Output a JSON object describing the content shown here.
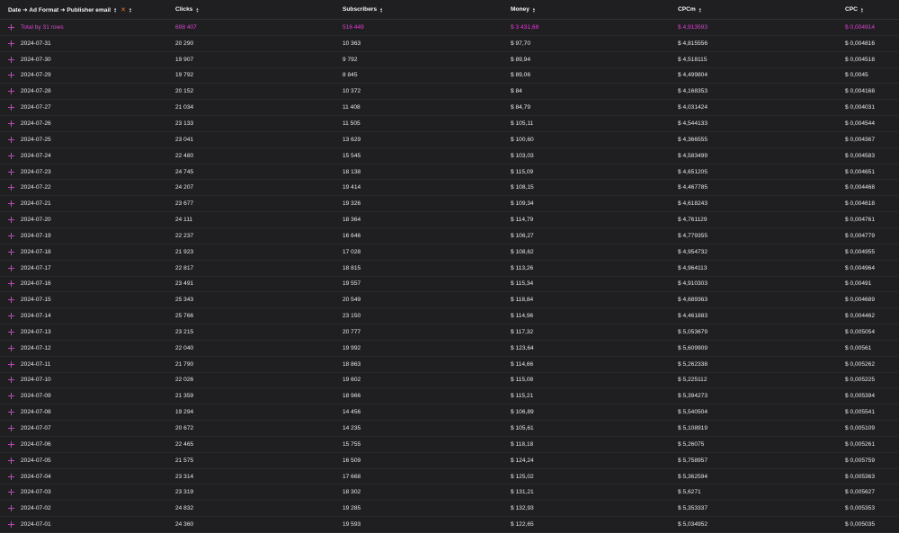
{
  "header": {
    "group_label": "Date ➜ Ad Format ➜ Publisher email",
    "close_glyph": "✕",
    "clicks": "Clicks",
    "subscribers": "Subscribers",
    "money": "Money",
    "cpcm": "CPCm",
    "cpc": "CPC"
  },
  "total": {
    "label": "Total by 31 rows",
    "clicks": "698 407",
    "subscribers": "516 449",
    "money": "$ 3 431,68",
    "cpcm": "$ 4,913593",
    "cpc": "$ 0,004914"
  },
  "rows": [
    {
      "date": "2024-07-31",
      "clicks": "20 290",
      "subscribers": "10 363",
      "money": "$ 97,70",
      "cpcm": "$ 4,815556",
      "cpc": "$ 0,004816"
    },
    {
      "date": "2024-07-30",
      "clicks": "19 907",
      "subscribers": "9 792",
      "money": "$ 89,94",
      "cpcm": "$ 4,518115",
      "cpc": "$ 0,004518"
    },
    {
      "date": "2024-07-29",
      "clicks": "19 792",
      "subscribers": "8 845",
      "money": "$ 89,06",
      "cpcm": "$ 4,499804",
      "cpc": "$ 0,0045"
    },
    {
      "date": "2024-07-28",
      "clicks": "20 152",
      "subscribers": "10 372",
      "money": "$ 84",
      "cpcm": "$ 4,168353",
      "cpc": "$ 0,004168"
    },
    {
      "date": "2024-07-27",
      "clicks": "21 034",
      "subscribers": "11 408",
      "money": "$ 84,79",
      "cpcm": "$ 4,031424",
      "cpc": "$ 0,004031"
    },
    {
      "date": "2024-07-26",
      "clicks": "23 133",
      "subscribers": "11 505",
      "money": "$ 105,11",
      "cpcm": "$ 4,544133",
      "cpc": "$ 0,004544"
    },
    {
      "date": "2024-07-25",
      "clicks": "23 041",
      "subscribers": "13 629",
      "money": "$ 100,60",
      "cpcm": "$ 4,366555",
      "cpc": "$ 0,004367"
    },
    {
      "date": "2024-07-24",
      "clicks": "22 480",
      "subscribers": "15 545",
      "money": "$ 103,03",
      "cpcm": "$ 4,583499",
      "cpc": "$ 0,004583"
    },
    {
      "date": "2024-07-23",
      "clicks": "24 745",
      "subscribers": "18 138",
      "money": "$ 115,09",
      "cpcm": "$ 4,651205",
      "cpc": "$ 0,004651"
    },
    {
      "date": "2024-07-22",
      "clicks": "24 207",
      "subscribers": "19 414",
      "money": "$ 108,15",
      "cpcm": "$ 4,467785",
      "cpc": "$ 0,004468"
    },
    {
      "date": "2024-07-21",
      "clicks": "23 677",
      "subscribers": "19 326",
      "money": "$ 109,34",
      "cpcm": "$ 4,618243",
      "cpc": "$ 0,004618"
    },
    {
      "date": "2024-07-20",
      "clicks": "24 111",
      "subscribers": "18 364",
      "money": "$ 114,79",
      "cpcm": "$ 4,761129",
      "cpc": "$ 0,004761"
    },
    {
      "date": "2024-07-19",
      "clicks": "22 237",
      "subscribers": "16 646",
      "money": "$ 106,27",
      "cpcm": "$ 4,779355",
      "cpc": "$ 0,004779"
    },
    {
      "date": "2024-07-18",
      "clicks": "21 923",
      "subscribers": "17 028",
      "money": "$ 108,62",
      "cpcm": "$ 4,954732",
      "cpc": "$ 0,004955"
    },
    {
      "date": "2024-07-17",
      "clicks": "22 817",
      "subscribers": "18 815",
      "money": "$ 113,26",
      "cpcm": "$ 4,964113",
      "cpc": "$ 0,004964"
    },
    {
      "date": "2024-07-16",
      "clicks": "23 491",
      "subscribers": "19 557",
      "money": "$ 115,34",
      "cpcm": "$ 4,910303",
      "cpc": "$ 0,00491"
    },
    {
      "date": "2024-07-15",
      "clicks": "25 343",
      "subscribers": "20 549",
      "money": "$ 118,84",
      "cpcm": "$ 4,689363",
      "cpc": "$ 0,004689"
    },
    {
      "date": "2024-07-14",
      "clicks": "25 766",
      "subscribers": "23 150",
      "money": "$ 114,96",
      "cpcm": "$ 4,461883",
      "cpc": "$ 0,004462"
    },
    {
      "date": "2024-07-13",
      "clicks": "23 215",
      "subscribers": "20 777",
      "money": "$ 117,32",
      "cpcm": "$ 5,053679",
      "cpc": "$ 0,005054"
    },
    {
      "date": "2024-07-12",
      "clicks": "22 040",
      "subscribers": "19 992",
      "money": "$ 123,64",
      "cpcm": "$ 5,609909",
      "cpc": "$ 0,00561"
    },
    {
      "date": "2024-07-11",
      "clicks": "21 790",
      "subscribers": "18 863",
      "money": "$ 114,66",
      "cpcm": "$ 5,262338",
      "cpc": "$ 0,005262"
    },
    {
      "date": "2024-07-10",
      "clicks": "22 026",
      "subscribers": "19 602",
      "money": "$ 115,08",
      "cpcm": "$ 5,225112",
      "cpc": "$ 0,005225"
    },
    {
      "date": "2024-07-09",
      "clicks": "21 359",
      "subscribers": "18 966",
      "money": "$ 115,21",
      "cpcm": "$ 5,394273",
      "cpc": "$ 0,005394"
    },
    {
      "date": "2024-07-08",
      "clicks": "19 294",
      "subscribers": "14 456",
      "money": "$ 106,89",
      "cpcm": "$ 5,540504",
      "cpc": "$ 0,005541"
    },
    {
      "date": "2024-07-07",
      "clicks": "20 672",
      "subscribers": "14 235",
      "money": "$ 105,61",
      "cpcm": "$ 5,108919",
      "cpc": "$ 0,005109"
    },
    {
      "date": "2024-07-06",
      "clicks": "22 465",
      "subscribers": "15 755",
      "money": "$ 118,18",
      "cpcm": "$ 5,26075",
      "cpc": "$ 0,005261"
    },
    {
      "date": "2024-07-05",
      "clicks": "21 575",
      "subscribers": "16 509",
      "money": "$ 124,24",
      "cpcm": "$ 5,758957",
      "cpc": "$ 0,005759"
    },
    {
      "date": "2024-07-04",
      "clicks": "23 314",
      "subscribers": "17 668",
      "money": "$ 125,02",
      "cpcm": "$ 5,362594",
      "cpc": "$ 0,005363"
    },
    {
      "date": "2024-07-03",
      "clicks": "23 319",
      "subscribers": "18 302",
      "money": "$ 131,21",
      "cpcm": "$ 5,6271",
      "cpc": "$ 0,005627"
    },
    {
      "date": "2024-07-02",
      "clicks": "24 832",
      "subscribers": "19 285",
      "money": "$ 132,93",
      "cpcm": "$ 5,353337",
      "cpc": "$ 0,005353"
    },
    {
      "date": "2024-07-01",
      "clicks": "24 360",
      "subscribers": "19 593",
      "money": "$ 122,65",
      "cpcm": "$ 5,034952",
      "cpc": "$ 0,005035"
    }
  ],
  "colors": {
    "background": "#1f1f21",
    "accent": "#e23fd6",
    "plus": "#c741c0",
    "close": "#e0702a"
  }
}
